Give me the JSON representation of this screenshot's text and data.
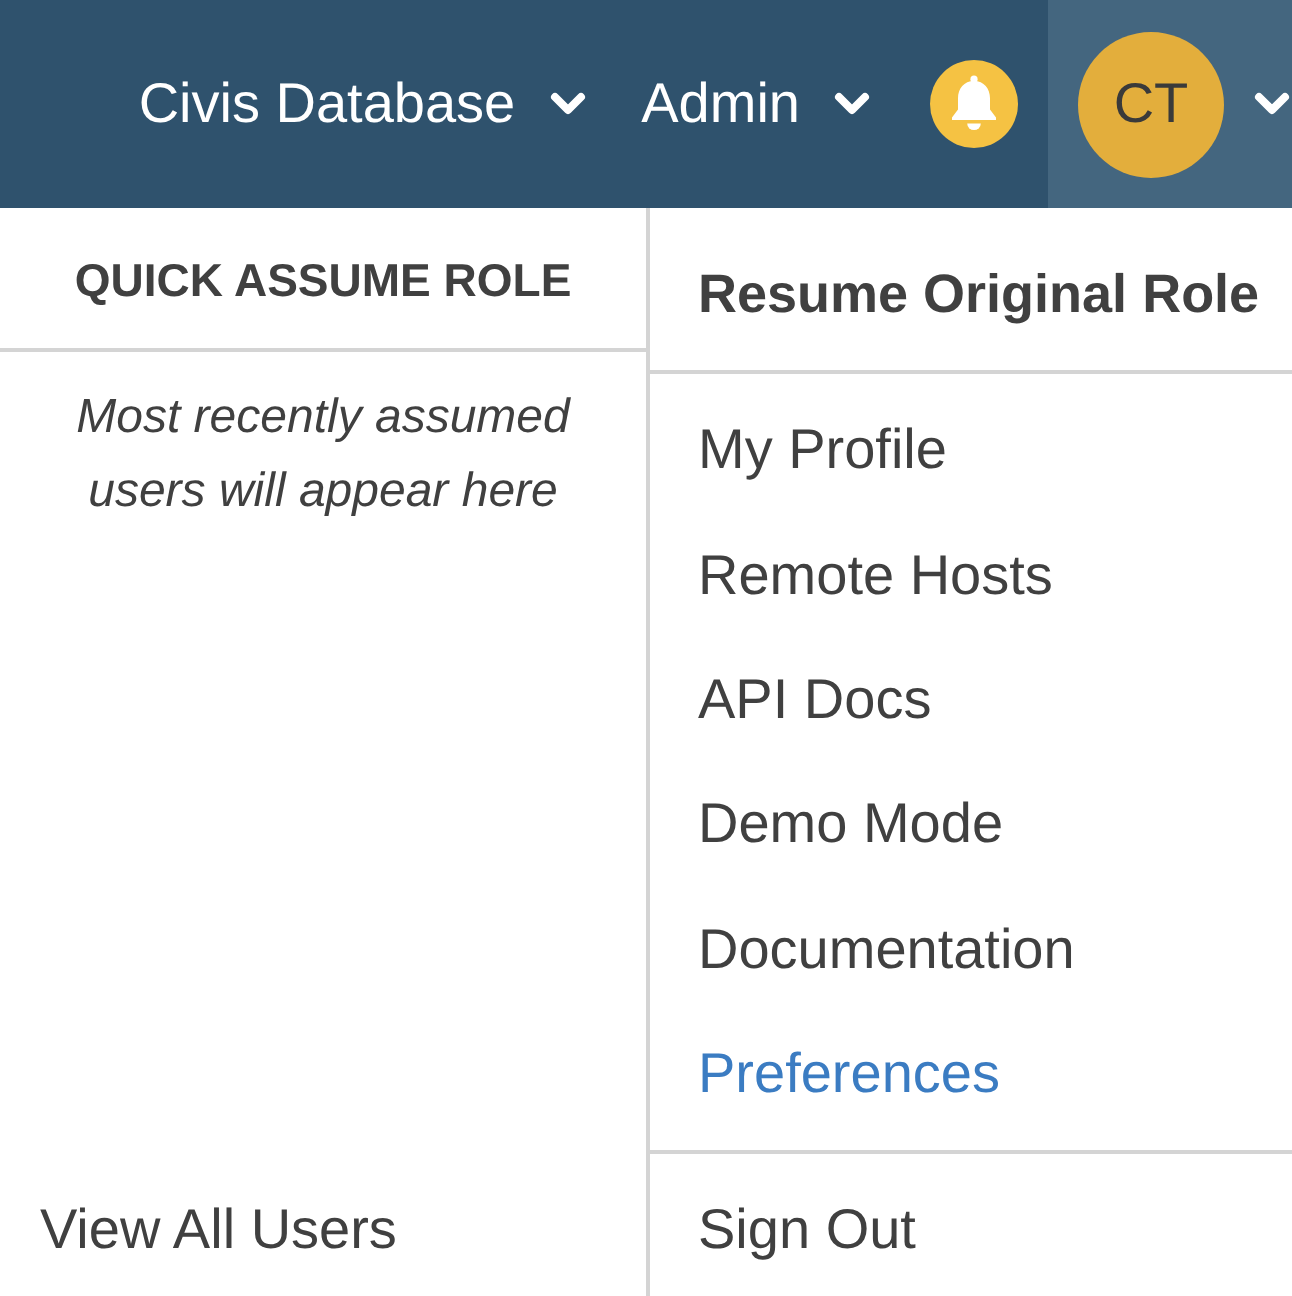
{
  "navbar": {
    "menus": [
      {
        "label": "Civis Database",
        "expanded": false
      },
      {
        "label": "Admin",
        "expanded": false
      }
    ],
    "user_menu": {
      "initials": "CT",
      "expanded": true
    }
  },
  "quick_assume_role": {
    "title": "QUICK ASSUME ROLE",
    "empty_message": "Most recently assumed users will appear here",
    "footer_link": "View All Users"
  },
  "account_menu": {
    "items": [
      {
        "kind": "header",
        "label": "Resume Original Role",
        "selected": false
      },
      {
        "kind": "item",
        "label": "My Profile",
        "selected": false
      },
      {
        "kind": "item",
        "label": "Remote Hosts",
        "selected": false
      },
      {
        "kind": "item",
        "label": "API Docs",
        "selected": false
      },
      {
        "kind": "item",
        "label": "Demo Mode",
        "selected": false
      },
      {
        "kind": "item",
        "label": "Documentation",
        "selected": false
      },
      {
        "kind": "item",
        "label": "Preferences",
        "selected": true
      },
      {
        "kind": "footer",
        "label": "Sign Out",
        "selected": false
      }
    ]
  }
}
